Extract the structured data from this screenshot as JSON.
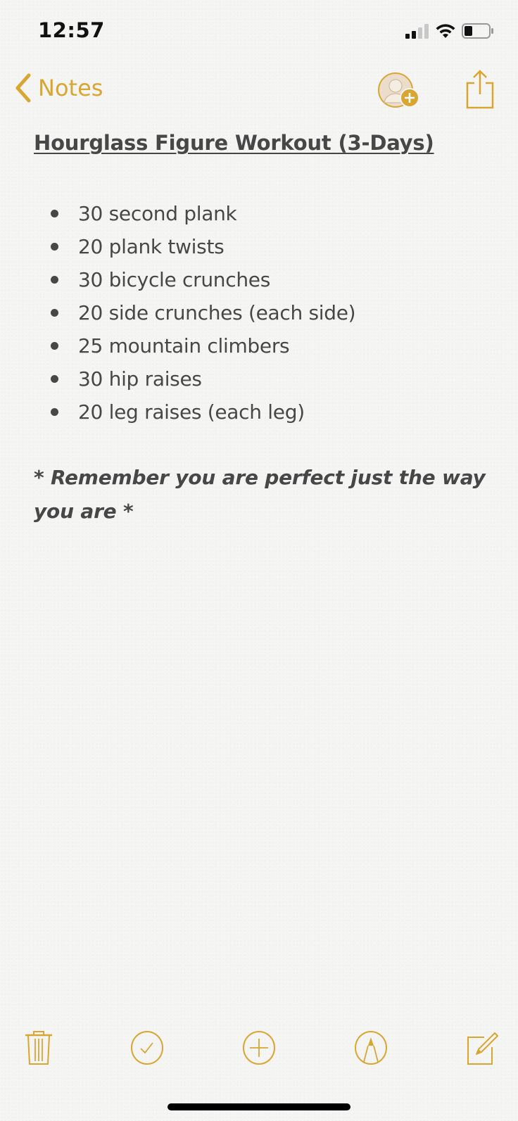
{
  "status_bar": {
    "time": "12:57",
    "signal_icon": "cellular-signal-icon",
    "wifi_icon": "wifi-icon",
    "battery_icon": "battery-icon"
  },
  "nav": {
    "back_label": "Notes",
    "back_icon": "chevron-left-icon",
    "collaborate_icon": "add-person-icon",
    "share_icon": "share-icon",
    "accent_color": "#d9a632"
  },
  "note": {
    "title": "Hourglass Figure Workout (3-Days)",
    "items": [
      "30 second plank",
      "20 plank twists",
      "30 bicycle crunches",
      "20 side crunches (each side)",
      "25 mountain climbers",
      "30 hip raises",
      "20 leg raises (each leg)"
    ],
    "quote": " * Remember you are perfect just the way you are *"
  },
  "toolbar": {
    "items": [
      {
        "name": "trash",
        "icon": "trash-icon"
      },
      {
        "name": "checklist",
        "icon": "checkmark-circle-icon"
      },
      {
        "name": "add",
        "icon": "plus-circle-icon"
      },
      {
        "name": "markup",
        "icon": "pen-circle-icon"
      },
      {
        "name": "compose",
        "icon": "compose-icon"
      }
    ]
  }
}
